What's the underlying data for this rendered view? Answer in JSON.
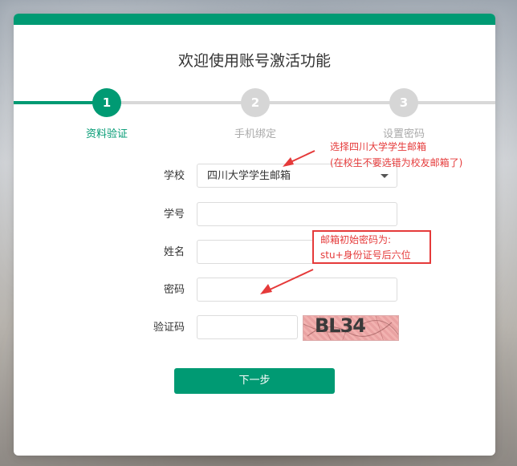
{
  "page": {
    "title": "欢迎使用账号激活功能"
  },
  "steps": [
    {
      "num": "1",
      "label": "资料验证",
      "active": true
    },
    {
      "num": "2",
      "label": "手机绑定",
      "active": false
    },
    {
      "num": "3",
      "label": "设置密码",
      "active": false
    }
  ],
  "form": {
    "school": {
      "label": "学校",
      "value": "四川大学学生邮箱"
    },
    "student_id": {
      "label": "学号",
      "value": ""
    },
    "name": {
      "label": "姓名",
      "value": ""
    },
    "password": {
      "label": "密码",
      "value": ""
    },
    "captcha": {
      "label": "验证码",
      "value": "",
      "image_text": "BL34"
    },
    "next_button": "下一步"
  },
  "annotations": {
    "school_note_line1": "选择四川大学学生邮箱",
    "school_note_line2": "(在校生不要选错为校友邮箱了)",
    "password_note_line1": "邮箱初始密码为:",
    "password_note_line2": "stu+身份证号后六位"
  },
  "colors": {
    "accent": "#009a73",
    "annotation": "#e53a3a",
    "inactive": "#d6d6d6"
  }
}
